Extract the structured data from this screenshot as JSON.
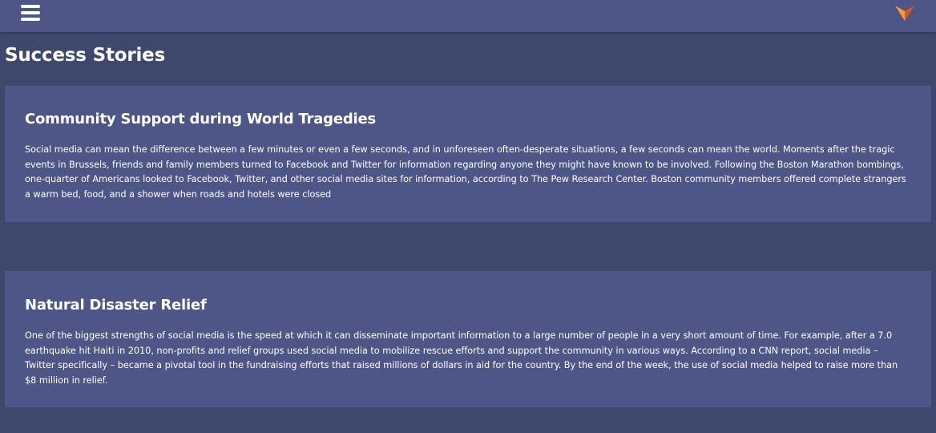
{
  "header": {
    "menu_icon": "hamburger-icon",
    "logo_icon": "orange-chevron-logo",
    "accent_color": "#f47a20"
  },
  "page": {
    "title": "Success Stories"
  },
  "stories": [
    {
      "title": "Community Support during World Tragedies",
      "body": "Social media can mean the difference between a few minutes or even a few seconds, and in unforeseen often-desperate situations, a few seconds can mean the world. Moments after the tragic events in Brussels, friends and family members turned to Facebook and Twitter for information regarding anyone they might have known to be involved. Following the Boston Marathon bombings, one-quarter of Americans looked to Facebook, Twitter, and other social media sites for information, according to The Pew Research Center. Boston community members offered complete strangers a warm bed, food, and a shower when roads and hotels were closed"
    },
    {
      "title": "Natural Disaster Relief",
      "body": "One of the biggest strengths of social media is the speed at which it can disseminate important information to a large number of people in a very short amount of time. For example, after a 7.0 earthquake hit Haiti in 2010, non-profits and relief groups used social media to mobilize rescue efforts and support the community in various ways. According to a CNN report, social media – Twitter specifically – became a pivotal tool in the fundraising efforts that raised millions of dollars in aid for the country. By the end of the week, the use of social media helped to raise more than $8 million in relief."
    }
  ]
}
